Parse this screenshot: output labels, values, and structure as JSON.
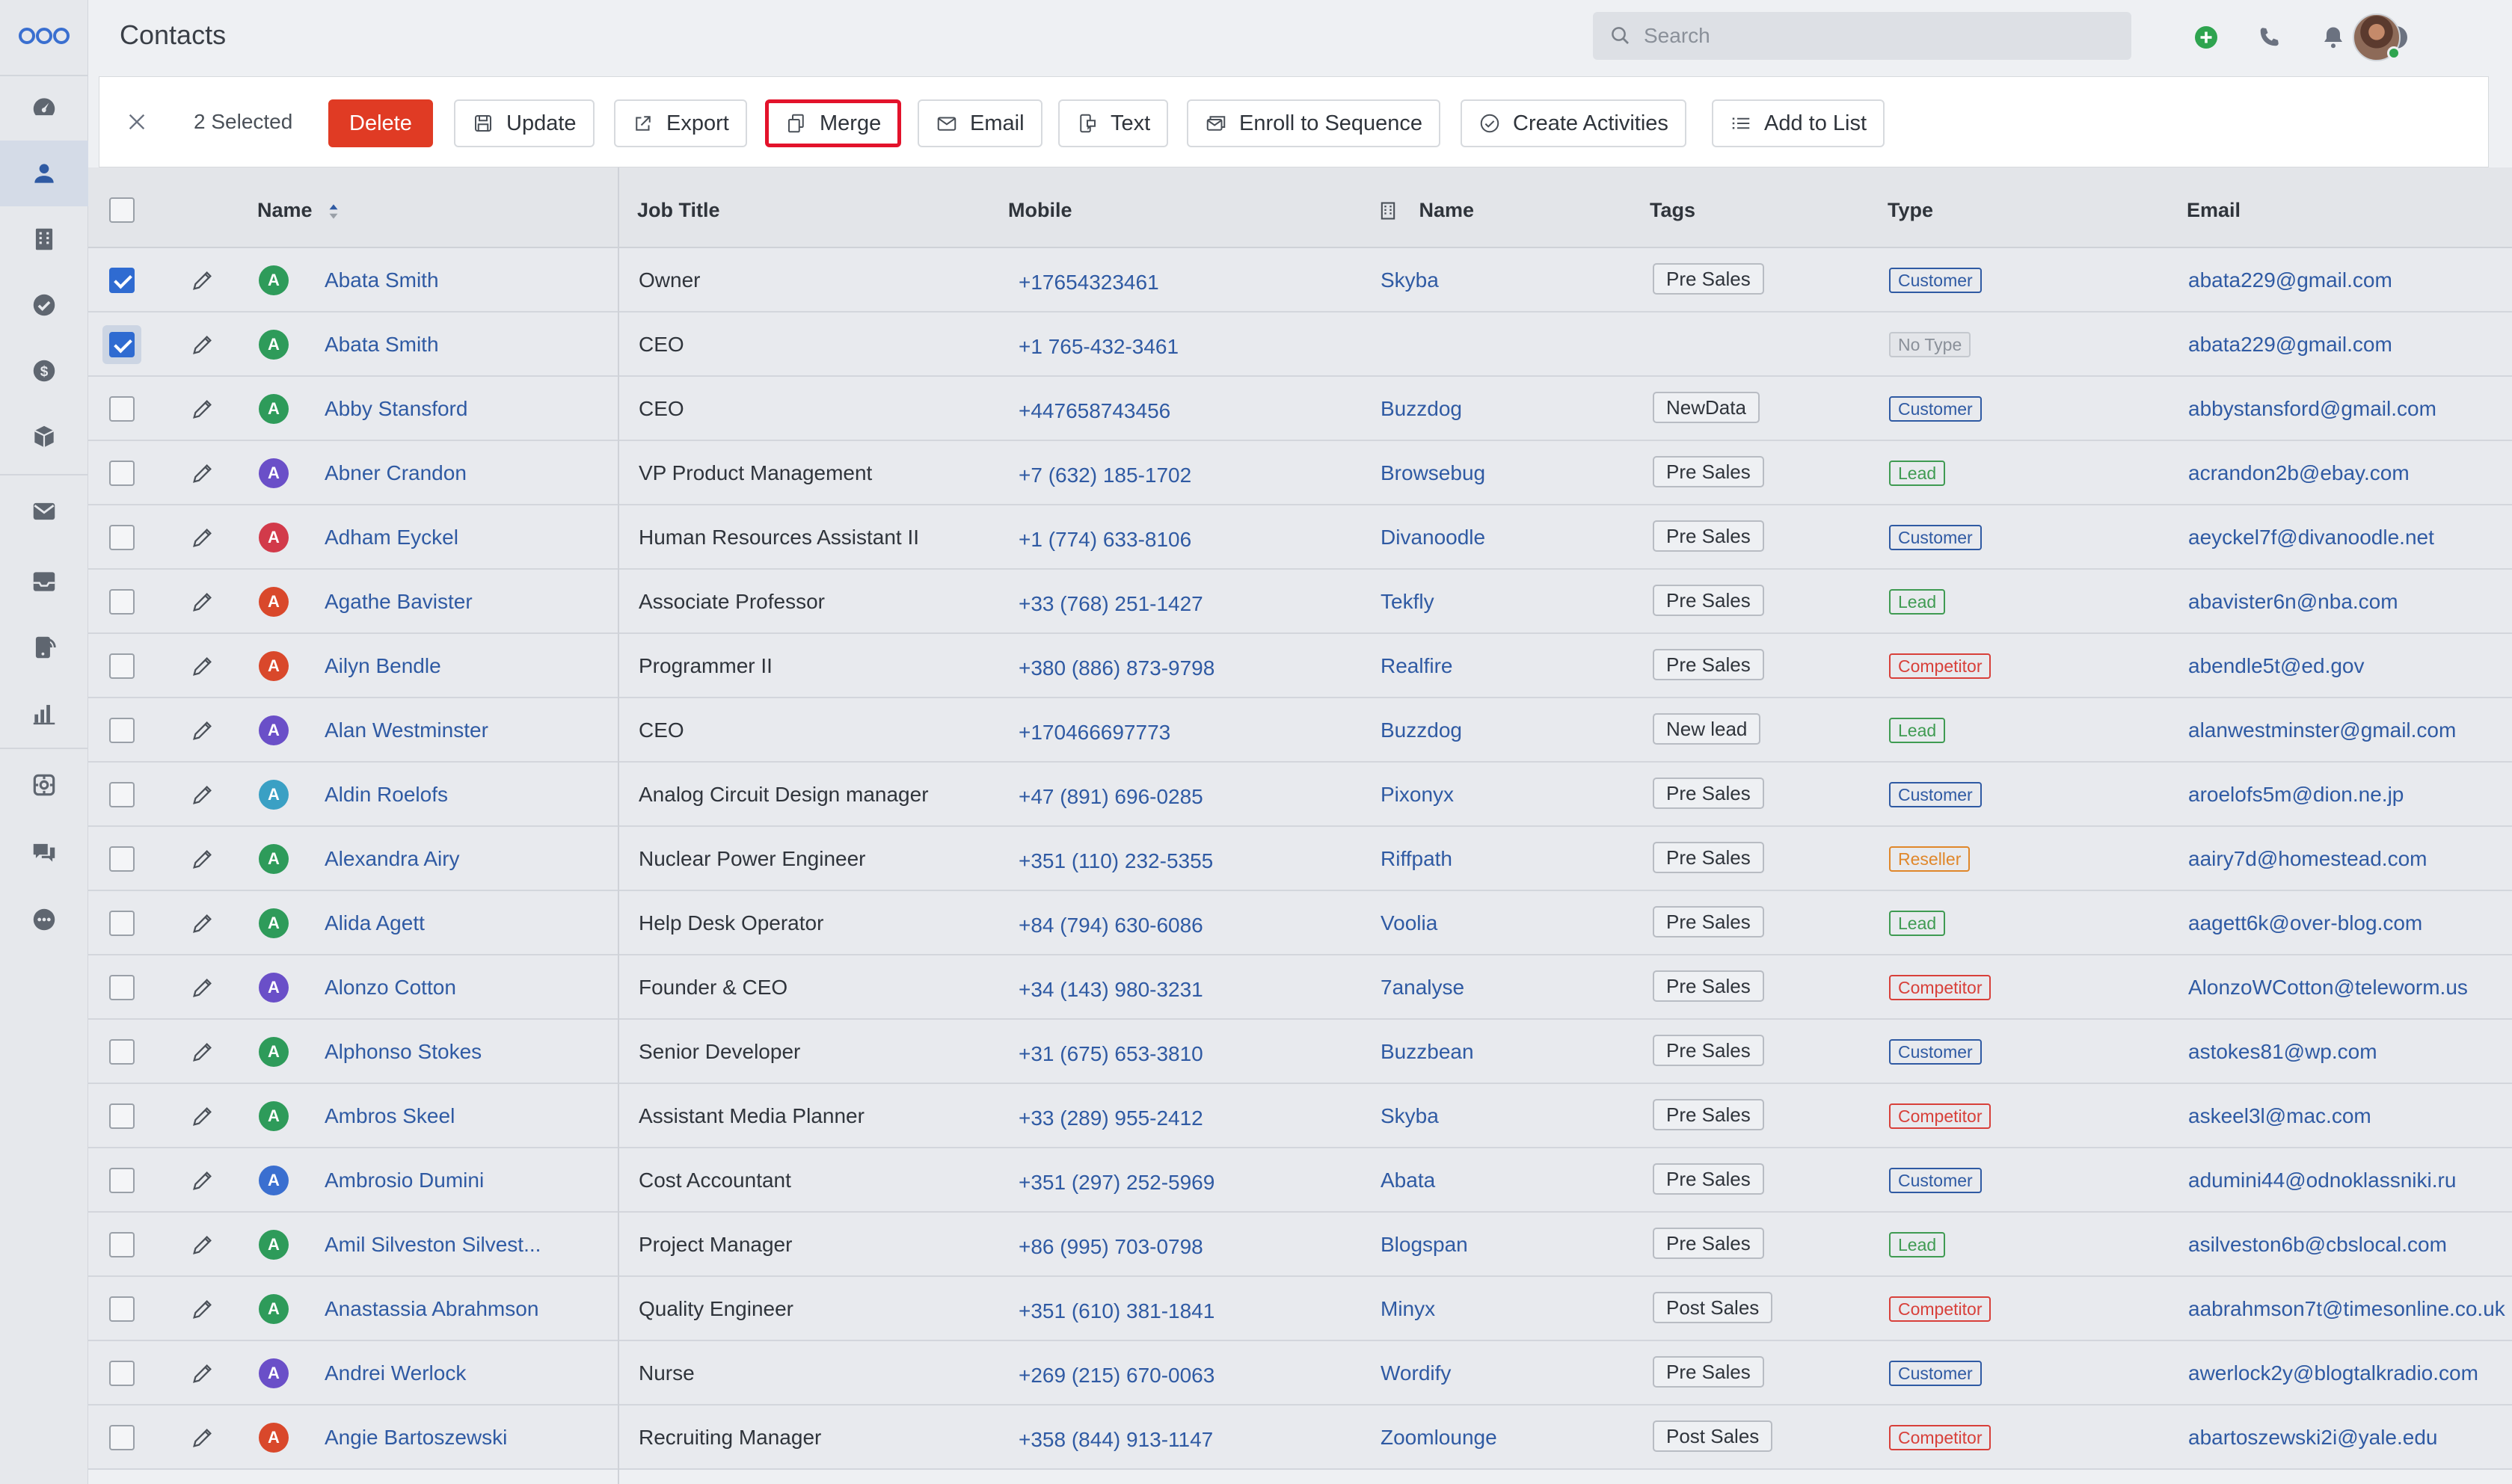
{
  "header": {
    "title": "Contacts",
    "search_placeholder": "Search"
  },
  "sidebar": {
    "items": [
      {
        "icon": "dashboard-icon"
      },
      {
        "icon": "contacts-icon",
        "active": true
      },
      {
        "icon": "companies-icon"
      },
      {
        "icon": "tasks-icon"
      },
      {
        "icon": "deals-icon"
      },
      {
        "icon": "products-icon"
      },
      {
        "icon": "email-icon"
      },
      {
        "icon": "inbox-icon"
      },
      {
        "icon": "phone-icon"
      },
      {
        "icon": "reports-icon"
      },
      {
        "icon": "automation-icon"
      },
      {
        "icon": "chat-icon"
      },
      {
        "icon": "more-icon"
      }
    ]
  },
  "toolbar": {
    "selected_label": "2 Selected",
    "delete": "Delete",
    "update": "Update",
    "export": "Export",
    "merge": "Merge",
    "email": "Email",
    "text": "Text",
    "enroll": "Enroll to Sequence",
    "create_activities": "Create Activities",
    "add_to_list": "Add to List"
  },
  "table": {
    "columns": {
      "name": "Name",
      "job_title": "Job Title",
      "mobile": "Mobile",
      "company_name": "Name",
      "tags": "Tags",
      "type": "Type",
      "email": "Email"
    },
    "rows": [
      {
        "checked": true,
        "initial": "A",
        "avatar_color": "#2e9b5a",
        "name": "Abata Smith",
        "job_title": "Owner",
        "mobile": "+17654323461",
        "company": "Skyba",
        "tag": "Pre Sales",
        "type": "Customer",
        "email": "abata229@gmail.com"
      },
      {
        "checked": true,
        "initial": "A",
        "avatar_color": "#2e9b5a",
        "name": "Abata Smith",
        "job_title": "CEO",
        "mobile": "+1 765-432-3461",
        "company": "",
        "tag": "",
        "type": "No Type",
        "email": "abata229@gmail.com"
      },
      {
        "checked": false,
        "initial": "A",
        "avatar_color": "#2e9b5a",
        "name": "Abby Stansford",
        "job_title": "CEO",
        "mobile": "+447658743456",
        "company": "Buzzdog",
        "tag": "NewData",
        "type": "Customer",
        "email": "abbystansford@gmail.com"
      },
      {
        "checked": false,
        "initial": "A",
        "avatar_color": "#6a4fc8",
        "name": "Abner Crandon",
        "job_title": "VP Product Management",
        "mobile": "+7 (632) 185-1702",
        "company": "Browsebug",
        "tag": "Pre Sales",
        "type": "Lead",
        "email": "acrandon2b@ebay.com"
      },
      {
        "checked": false,
        "initial": "A",
        "avatar_color": "#d23a4a",
        "name": "Adham Eyckel",
        "job_title": "Human Resources Assistant II",
        "mobile": "+1 (774) 633-8106",
        "company": "Divanoodle",
        "tag": "Pre Sales",
        "type": "Customer",
        "email": "aeyckel7f@divanoodle.net"
      },
      {
        "checked": false,
        "initial": "A",
        "avatar_color": "#d9482b",
        "name": "Agathe Bavister",
        "job_title": "Associate Professor",
        "mobile": "+33 (768) 251-1427",
        "company": "Tekfly",
        "tag": "Pre Sales",
        "type": "Lead",
        "email": "abavister6n@nba.com"
      },
      {
        "checked": false,
        "initial": "A",
        "avatar_color": "#d9482b",
        "name": "Ailyn Bendle",
        "job_title": "Programmer II",
        "mobile": "+380 (886) 873-9798",
        "company": "Realfire",
        "tag": "Pre Sales",
        "type": "Competitor",
        "email": "abendle5t@ed.gov"
      },
      {
        "checked": false,
        "initial": "A",
        "avatar_color": "#6a4fc8",
        "name": "Alan Westminster",
        "job_title": "CEO",
        "mobile": "+170466697773",
        "company": "Buzzdog",
        "tag": "New lead",
        "type": "Lead",
        "email": "alanwestminster@gmail.com"
      },
      {
        "checked": false,
        "initial": "A",
        "avatar_color": "#3aa0c4",
        "name": "Aldin Roelofs",
        "job_title": "Analog Circuit Design manager",
        "mobile": "+47 (891) 696-0285",
        "company": "Pixonyx",
        "tag": "Pre Sales",
        "type": "Customer",
        "email": "aroelofs5m@dion.ne.jp"
      },
      {
        "checked": false,
        "initial": "A",
        "avatar_color": "#2e9b5a",
        "name": "Alexandra Airy",
        "job_title": "Nuclear Power Engineer",
        "mobile": "+351 (110) 232-5355",
        "company": "Riffpath",
        "tag": "Pre Sales",
        "type": "Reseller",
        "email": "aairy7d@homestead.com"
      },
      {
        "checked": false,
        "initial": "A",
        "avatar_color": "#2e9b5a",
        "name": "Alida Agett",
        "job_title": "Help Desk Operator",
        "mobile": "+84 (794) 630-6086",
        "company": "Voolia",
        "tag": "Pre Sales",
        "type": "Lead",
        "email": "aagett6k@over-blog.com"
      },
      {
        "checked": false,
        "initial": "A",
        "avatar_color": "#6a4fc8",
        "name": "Alonzo Cotton",
        "job_title": "Founder & CEO",
        "mobile": "+34 (143) 980-3231",
        "company": "7analyse",
        "tag": "Pre Sales",
        "type": "Competitor",
        "email": "AlonzoWCotton@teleworm.us"
      },
      {
        "checked": false,
        "initial": "A",
        "avatar_color": "#2e9b5a",
        "name": "Alphonso Stokes",
        "job_title": "Senior Developer",
        "mobile": "+31 (675) 653-3810",
        "company": "Buzzbean",
        "tag": "Pre Sales",
        "type": "Customer",
        "email": "astokes81@wp.com"
      },
      {
        "checked": false,
        "initial": "A",
        "avatar_color": "#2e9b5a",
        "name": "Ambros Skeel",
        "job_title": "Assistant Media Planner",
        "mobile": "+33 (289) 955-2412",
        "company": "Skyba",
        "tag": "Pre Sales",
        "type": "Competitor",
        "email": "askeel3l@mac.com"
      },
      {
        "checked": false,
        "initial": "A",
        "avatar_color": "#3a6fd0",
        "name": "Ambrosio Dumini",
        "job_title": "Cost Accountant",
        "mobile": "+351 (297) 252-5969",
        "company": "Abata",
        "tag": "Pre Sales",
        "type": "Customer",
        "email": "adumini44@odnoklassniki.ru"
      },
      {
        "checked": false,
        "initial": "A",
        "avatar_color": "#2e9b5a",
        "name": "Amil Silveston Silvest...",
        "job_title": "Project Manager",
        "mobile": "+86 (995) 703-0798",
        "company": "Blogspan",
        "tag": "Pre Sales",
        "type": "Lead",
        "email": "asilveston6b@cbslocal.com"
      },
      {
        "checked": false,
        "initial": "A",
        "avatar_color": "#2e9b5a",
        "name": "Anastassia Abrahmson",
        "job_title": "Quality Engineer",
        "mobile": "+351 (610) 381-1841",
        "company": "Minyx",
        "tag": "Post Sales",
        "type": "Competitor",
        "email": "aabrahmson7t@timesonline.co.uk"
      },
      {
        "checked": false,
        "initial": "A",
        "avatar_color": "#6a4fc8",
        "name": "Andrei Werlock",
        "job_title": "Nurse",
        "mobile": "+269 (215) 670-0063",
        "company": "Wordify",
        "tag": "Pre Sales",
        "type": "Customer",
        "email": "awerlock2y@blogtalkradio.com"
      },
      {
        "checked": false,
        "initial": "A",
        "avatar_color": "#d9482b",
        "name": "Angie Bartoszewski",
        "job_title": "Recruiting Manager",
        "mobile": "+358 (844) 913-1147",
        "company": "Zoomlounge",
        "tag": "Post Sales",
        "type": "Competitor",
        "email": "abartoszewski2i@yale.edu"
      }
    ]
  },
  "type_colors": {
    "Customer": "#2f5aa3",
    "Lead": "#3f9b52",
    "Competitor": "#d8403a",
    "Reseller": "#e0872a",
    "No Type": "#8a9099"
  },
  "accent": "#e03b24"
}
